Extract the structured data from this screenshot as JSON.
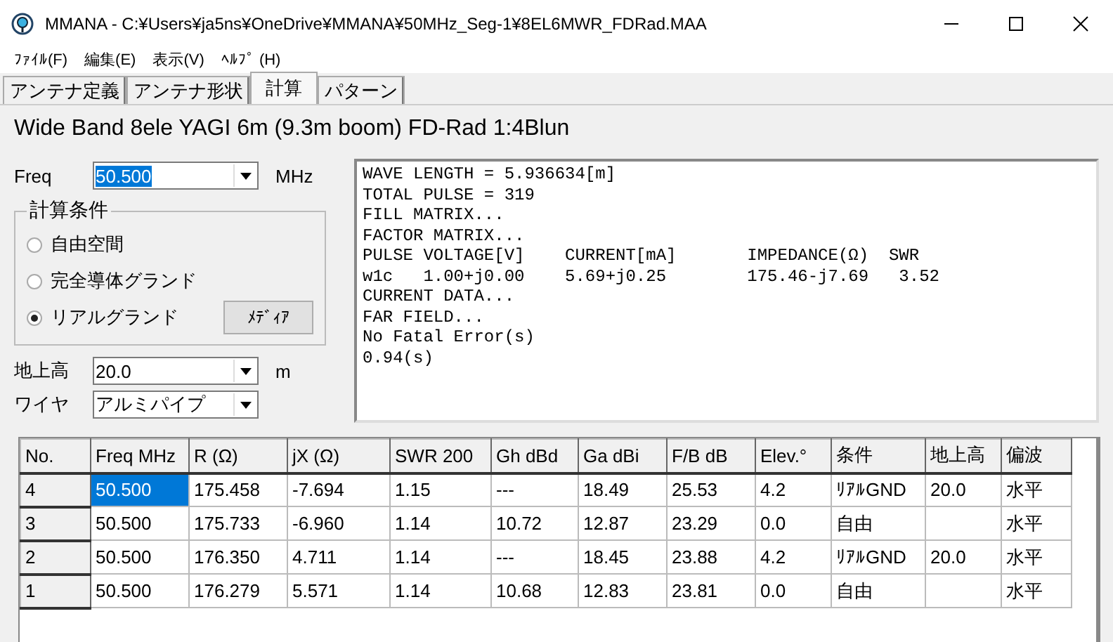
{
  "window": {
    "title": "MMANA - C:¥Users¥ja5ns¥OneDrive¥MMANA¥50MHz_Seg-1¥8EL6MWR_FDRad.MAA"
  },
  "menu": [
    "ﾌｧｲﾙ(F)",
    "編集(E)",
    "表示(V)",
    "ﾍﾙﾌﾟ (H)"
  ],
  "tabs": [
    {
      "label": "アンテナ定義",
      "selected": false
    },
    {
      "label": "アンテナ形状",
      "selected": false
    },
    {
      "label": "計算",
      "selected": true
    },
    {
      "label": "パターン",
      "selected": false
    }
  ],
  "antenna_name": "Wide Band 8ele YAGI 6m (9.3m boom) FD-Rad 1:4Blun",
  "freq": {
    "label": "Freq",
    "value": "50.500",
    "unit": "MHz"
  },
  "conditions": {
    "title": "計算条件",
    "options": [
      {
        "label": "自由空間",
        "selected": false
      },
      {
        "label": "完全導体グランド",
        "selected": false
      },
      {
        "label": "リアルグランド",
        "selected": true
      }
    ],
    "media_button": "ﾒﾃﾞｨｱ"
  },
  "height": {
    "label": "地上高",
    "value": "20.0",
    "unit": "m"
  },
  "wire": {
    "label": "ワイヤ",
    "value": "アルミパイプ"
  },
  "output": [
    "WAVE LENGTH = 5.936634[m]",
    "TOTAL PULSE = 319",
    "FILL MATRIX...",
    "FACTOR MATRIX...",
    "PULSE VOLTAGE[V]    CURRENT[mA]       IMPEDANCE(Ω)  SWR",
    "w1c   1.00+j0.00    5.69+j0.25        175.46-j7.69   3.52",
    "CURRENT DATA...",
    "FAR FIELD...",
    "No Fatal Error(s)",
    "0.94(s)"
  ],
  "table": {
    "columns": [
      "No.",
      "Freq MHz",
      "R (Ω)",
      "jX (Ω)",
      "SWR 200",
      "Gh dBd",
      "Ga dBi",
      "F/B dB",
      "Elev.°",
      "条件",
      "地上高",
      "偏波"
    ],
    "rows": [
      {
        "selected": true,
        "cells": [
          "4",
          "50.500",
          "175.458",
          "-7.694",
          "1.15",
          "---",
          "18.49",
          "25.53",
          "4.2",
          "ﾘｱﾙGND",
          "20.0",
          "水平"
        ]
      },
      {
        "selected": false,
        "cells": [
          "3",
          "50.500",
          "175.733",
          "-6.960",
          "1.14",
          "10.72",
          "12.87",
          "23.29",
          "0.0",
          "自由",
          "",
          "水平"
        ]
      },
      {
        "selected": false,
        "cells": [
          "2",
          "50.500",
          "176.350",
          "4.711",
          "1.14",
          "---",
          "18.45",
          "23.88",
          "4.2",
          "ﾘｱﾙGND",
          "20.0",
          "水平"
        ]
      },
      {
        "selected": false,
        "cells": [
          "1",
          "50.500",
          "176.279",
          "5.571",
          "1.14",
          "10.68",
          "12.83",
          "23.81",
          "0.0",
          "自由",
          "",
          "水平"
        ]
      }
    ]
  }
}
